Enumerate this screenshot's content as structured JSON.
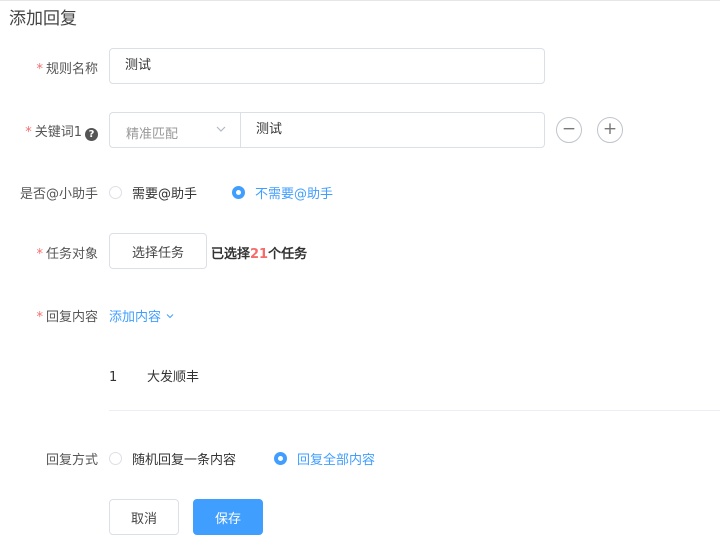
{
  "page": {
    "title": "添加回复"
  },
  "form": {
    "rule_name": {
      "label": "规则名称",
      "value": "测试"
    },
    "keyword": {
      "label": "关键词1",
      "match_type": "精准匹配",
      "value": "测试",
      "remove_symbol": "−",
      "add_symbol": "+"
    },
    "assistant": {
      "label": "是否@小助手",
      "options": [
        {
          "label": "需要@助手",
          "selected": false
        },
        {
          "label": "不需要@助手",
          "selected": true
        }
      ]
    },
    "task": {
      "label": "任务对象",
      "button_label": "选择任务",
      "selected_prefix": "已选择",
      "selected_count": "21",
      "selected_suffix": "个任务"
    },
    "reply_content": {
      "label": "回复内容",
      "add_label": "添加内容",
      "items": [
        {
          "index": "1",
          "text": "大发顺丰"
        }
      ]
    },
    "reply_mode": {
      "label": "回复方式",
      "options": [
        {
          "label": "随机回复一条内容",
          "selected": false
        },
        {
          "label": "回复全部内容",
          "selected": true
        }
      ]
    },
    "actions": {
      "cancel": "取消",
      "save": "保存"
    }
  },
  "colors": {
    "primary": "#409eff",
    "required": "#f56c6c",
    "count": "#f56c6c"
  },
  "icons": {
    "info": "question-circle-icon",
    "select_arrow": "chevron-down-icon"
  }
}
